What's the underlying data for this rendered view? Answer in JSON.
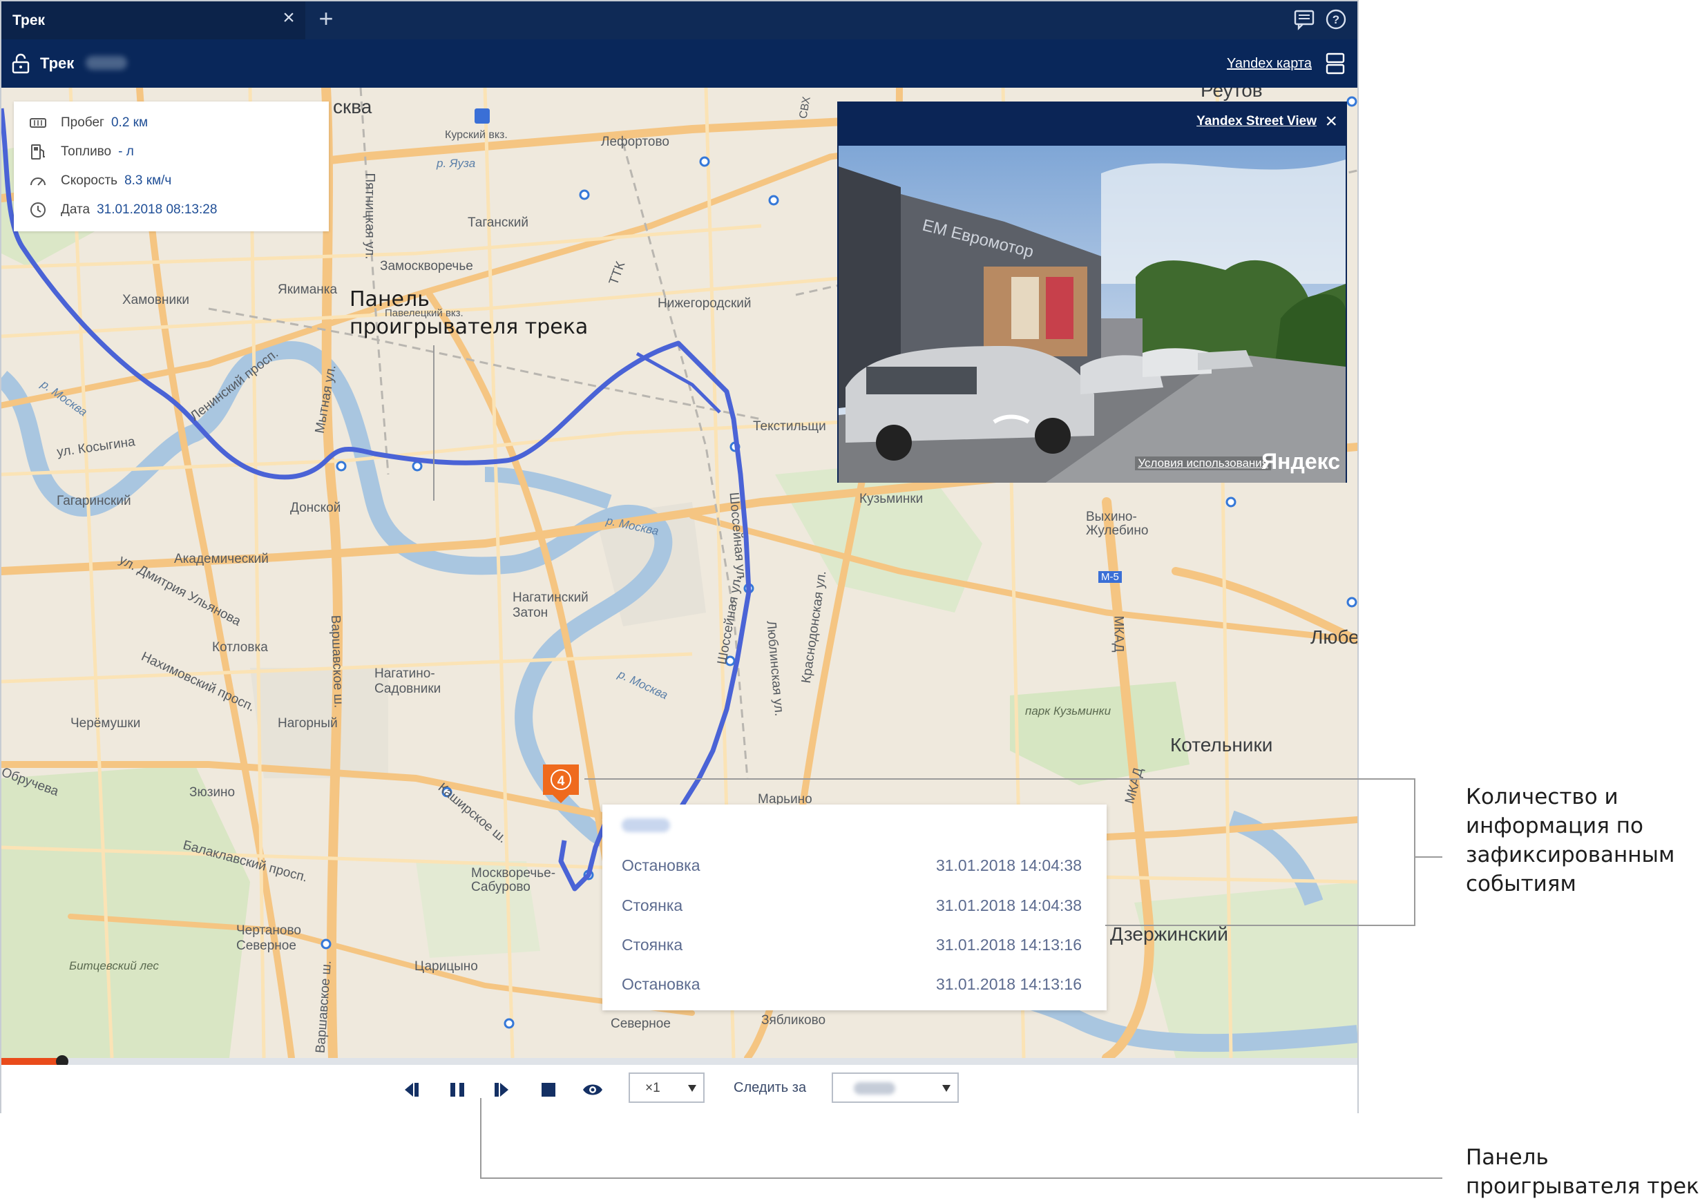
{
  "tab": {
    "title": "Трек"
  },
  "toolbar": {
    "track_label": "Трек",
    "map_provider": "Yandex карта"
  },
  "info": {
    "mileage_label": "Пробег",
    "mileage_value": "0.2 км",
    "fuel_label": "Топливо",
    "fuel_value": "- л",
    "speed_label": "Скорость",
    "speed_value": "8.3 км/ч",
    "date_label": "Дата",
    "date_value": "31.01.2018 08:13:28"
  },
  "street_view": {
    "title": "Yandex Street View",
    "terms": "Условия использования",
    "brand": "Яндекс"
  },
  "events": {
    "count": "4",
    "items": [
      {
        "type": "Остановка",
        "time": "31.01.2018 14:04:38"
      },
      {
        "type": "Стоянка",
        "time": "31.01.2018 14:04:38"
      },
      {
        "type": "Стоянка",
        "time": "31.01.2018 14:13:16"
      },
      {
        "type": "Остановка",
        "time": "31.01.2018 14:13:16"
      }
    ]
  },
  "player": {
    "speed": "×1",
    "follow_label": "Следить за",
    "progress_fraction": 0.045
  },
  "map_labels": {
    "moskva": "сква",
    "reutov": "Реутов",
    "kursky": "Курский вкз.",
    "lefortovo": "Лефортово",
    "yauza": "р. Яуза",
    "taganskiy": "Таганский",
    "zamoskvorechye": "Замоскворечье",
    "khamovniki": "Хамовники",
    "yakimanka": "Якиманка",
    "nizhegorodsky": "Нижегородский",
    "tekstilshchiki": "Текстильщи",
    "ttk": "ТТК",
    "leninsky": "Ленинский просп.",
    "moskva_river": "р. Москва",
    "kosygina": "ул. Косыгина",
    "gagarinsky": "Гагаринский",
    "donskoy": "Донской",
    "akademichesky": "Академический",
    "kuzminki": "Кузьминки",
    "vykhino": "Выхино-\nЖулебино",
    "nagatinsky": "Нагатинский\nЗатон",
    "kotlovka": "Котловка",
    "nagatino": "Нагатино-\nСадовники",
    "cheryomushki": "Черёмушки",
    "nagorny": "Нагорный",
    "zyuzino": "Зюзино",
    "obrucheva": "Обручева",
    "balaklavsky": "Балаклавский просп.",
    "kashirskoe": "Каширское ш.",
    "moskvorechye": "Москворечье-\nСабурово",
    "chertanovo": "Чертаново\nСеверное",
    "bitsevsky": "Битцевский лес",
    "tsaritsyno": "Царицыно",
    "kotelniki": "Котельники",
    "dzerzhinsky": "Дзержинский",
    "lyube": "Любе",
    "park_kuzminki": "парк Кузьминки",
    "mkad": "МКАД",
    "marino": "Марьино",
    "zyablikovo": "Зябликово",
    "severnoe": "Северное",
    "shosseinaya": "Шоссейная ул.",
    "lyublinskaya": "Люблинская ул.",
    "krasnodonskaya": "Краснодонская ул.",
    "varshavskoe": "Варшавское ш.",
    "patriarchy": "Пятницкая ул.",
    "mytnaya": "Мытная ул.",
    "nakhimovsky": "Нахимовский просп.",
    "dm_ulyanova": "ул. Дмитрия Ульянова",
    "m5": "М-5",
    "svkh": "СВХ",
    "kurskiy_small": "Павелецкий вкз."
  },
  "callouts": {
    "player_panel_map": "Панель\nпроигрывателя трека",
    "events_info": "Количество и\nинформация по\nзафиксированным\nсобытиям",
    "player_panel_bottom": "Панель\nпроигрывателя трека"
  },
  "colors": {
    "header": "#0f2a56",
    "track": "#4a63d6",
    "event_marker": "#ef6a1d",
    "progress": "#e94b1b"
  }
}
